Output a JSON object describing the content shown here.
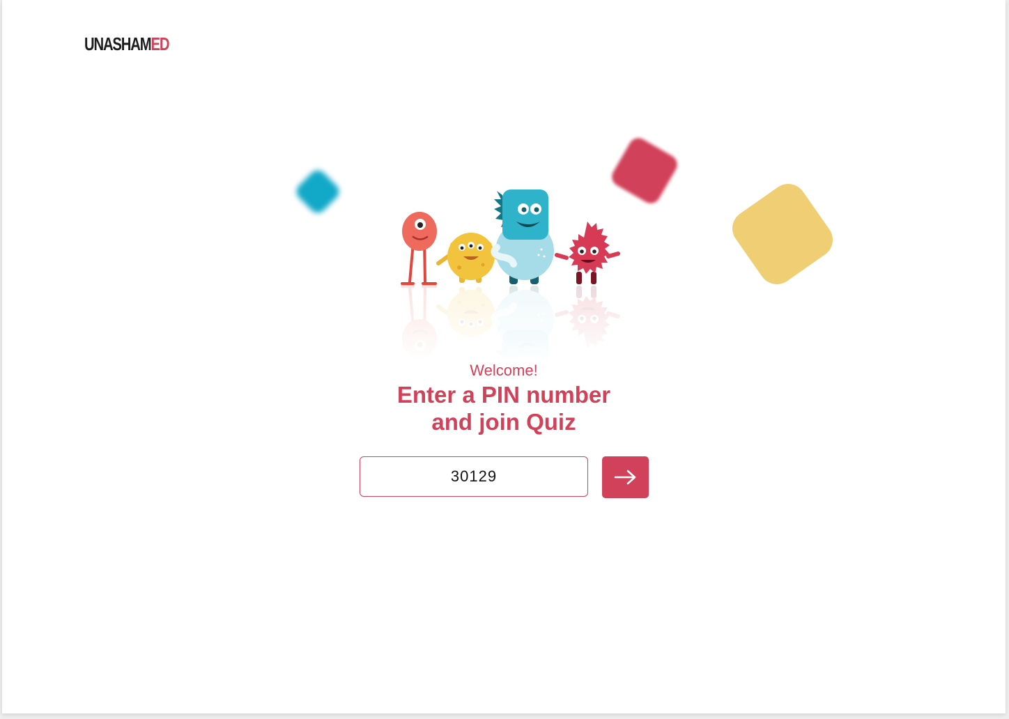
{
  "brand": {
    "logo_dark": "UNASHAM",
    "logo_accent": "ED"
  },
  "colors": {
    "accent": "#d14159",
    "cyan": "#12a8c8",
    "yellow": "#f0ce74"
  },
  "hero": {
    "welcome": "Welcome!",
    "headline_line1": "Enter a PIN number",
    "headline_line2": "and join Quiz"
  },
  "pin_form": {
    "pin_value": "30129",
    "submit_icon": "arrow-right-icon"
  }
}
